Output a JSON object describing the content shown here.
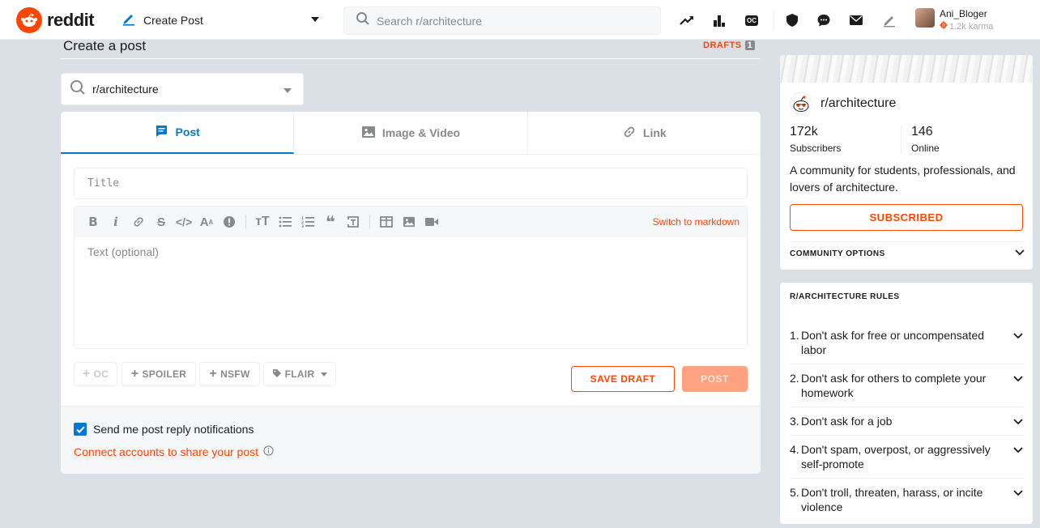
{
  "topbar": {
    "logo_text": "reddit",
    "home_dropdown_label": "Create Post",
    "search_placeholder": "Search r/architecture",
    "oc_label": "OC",
    "user": {
      "name": "Ani_Bloger",
      "karma": "1.2k karma"
    }
  },
  "header": {
    "title": "Create a post",
    "drafts_label": "DRAFTS",
    "drafts_count": "1"
  },
  "community_picker": {
    "label": "r/architecture"
  },
  "tabs": [
    {
      "label": "Post",
      "icon": "post-icon",
      "active": true
    },
    {
      "label": "Image & Video",
      "icon": "image-icon",
      "active": false
    },
    {
      "label": "Link",
      "icon": "link-icon",
      "active": false
    }
  ],
  "editor": {
    "title_placeholder": "Title",
    "body_placeholder": "Text (optional)",
    "markdown_switch": "Switch to markdown",
    "toolbar": [
      "bold",
      "italic",
      "link",
      "strikethrough",
      "inline-code",
      "superscript",
      "spoiler",
      "heading",
      "bulleted-list",
      "numbered-list",
      "quote-block",
      "code-block",
      "table",
      "image",
      "video"
    ]
  },
  "tags": {
    "oc": "OC",
    "spoiler": "SPOILER",
    "nsfw": "NSFW",
    "flair": "FLAIR"
  },
  "actions": {
    "save_draft": "SAVE DRAFT",
    "post": "POST"
  },
  "footer": {
    "notifications_label": "Send me post reply notifications",
    "notifications_checked": true,
    "connect_label": "Connect accounts to share your post"
  },
  "community": {
    "name": "r/architecture",
    "subscribers": "172k",
    "subscribers_label": "Subscribers",
    "online": "146",
    "online_label": "Online",
    "description": "A community for students, professionals, and lovers of architecture.",
    "subscribed_label": "SUBSCRIBED",
    "options_label": "COMMUNITY OPTIONS"
  },
  "rules": {
    "title": "R/ARCHITECTURE RULES",
    "items": [
      {
        "num": "1.",
        "text": "Don't ask for free or uncompensated labor"
      },
      {
        "num": "2.",
        "text": "Don't ask for others to complete your homework"
      },
      {
        "num": "3.",
        "text": "Don't ask for a job"
      },
      {
        "num": "4.",
        "text": "Don't spam, overpost, or aggressively self-promote"
      },
      {
        "num": "5.",
        "text": "Don't troll, threaten, harass, or incite violence"
      }
    ]
  },
  "colors": {
    "brand": "#ff4500",
    "accent": "#0079d3",
    "background": "#dae0e6"
  }
}
